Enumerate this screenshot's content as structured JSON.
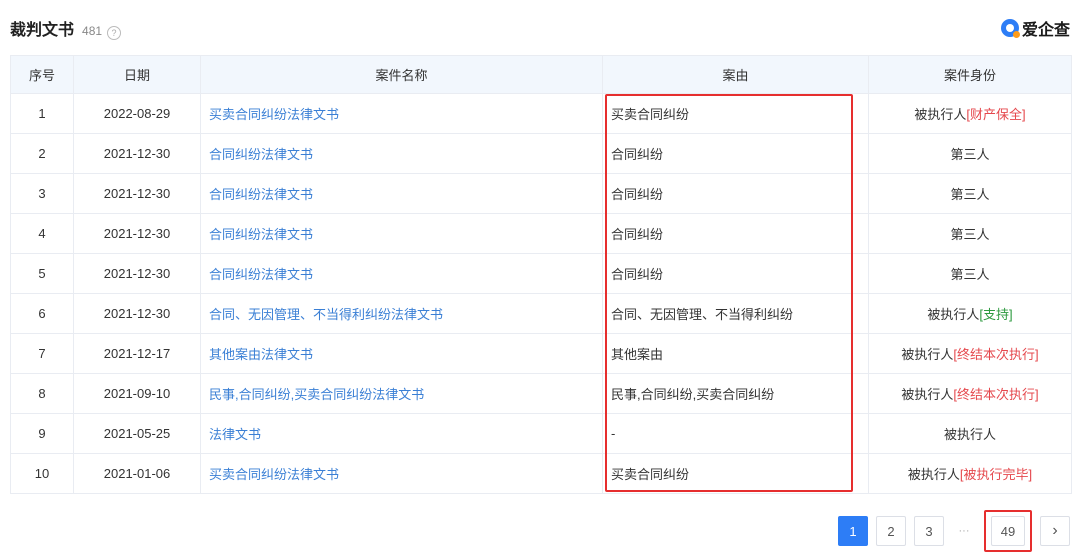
{
  "header": {
    "title": "裁判文书",
    "count": "481",
    "help_glyph": "?",
    "brand": "爱企查"
  },
  "table": {
    "columns": [
      "序号",
      "日期",
      "案件名称",
      "案由",
      "案件身份"
    ],
    "rows": [
      {
        "no": "1",
        "date": "2022-08-29",
        "name": "买卖合同纠纷法律文书",
        "cause": "买卖合同纠纷",
        "role": "被执行人",
        "role_suffix": "[财产保全]",
        "suffix_color": "red"
      },
      {
        "no": "2",
        "date": "2021-12-30",
        "name": "合同纠纷法律文书",
        "cause": "合同纠纷",
        "role": "第三人",
        "role_suffix": "",
        "suffix_color": ""
      },
      {
        "no": "3",
        "date": "2021-12-30",
        "name": "合同纠纷法律文书",
        "cause": "合同纠纷",
        "role": "第三人",
        "role_suffix": "",
        "suffix_color": ""
      },
      {
        "no": "4",
        "date": "2021-12-30",
        "name": "合同纠纷法律文书",
        "cause": "合同纠纷",
        "role": "第三人",
        "role_suffix": "",
        "suffix_color": ""
      },
      {
        "no": "5",
        "date": "2021-12-30",
        "name": "合同纠纷法律文书",
        "cause": "合同纠纷",
        "role": "第三人",
        "role_suffix": "",
        "suffix_color": ""
      },
      {
        "no": "6",
        "date": "2021-12-30",
        "name": "合同、无因管理、不当得利纠纷法律文书",
        "cause": "合同、无因管理、不当得利纠纷",
        "role": "被执行人",
        "role_suffix": "[支持]",
        "suffix_color": "green"
      },
      {
        "no": "7",
        "date": "2021-12-17",
        "name": "其他案由法律文书",
        "cause": "其他案由",
        "role": "被执行人",
        "role_suffix": "[终结本次执行]",
        "suffix_color": "red"
      },
      {
        "no": "8",
        "date": "2021-09-10",
        "name": "民事,合同纠纷,买卖合同纠纷法律文书",
        "cause": "民事,合同纠纷,买卖合同纠纷",
        "role": "被执行人",
        "role_suffix": "[终结本次执行]",
        "suffix_color": "red"
      },
      {
        "no": "9",
        "date": "2021-05-25",
        "name": "法律文书",
        "cause": "-",
        "role": "被执行人",
        "role_suffix": "",
        "suffix_color": ""
      },
      {
        "no": "10",
        "date": "2021-01-06",
        "name": "买卖合同纠纷法律文书",
        "cause": "买卖合同纠纷",
        "role": "被执行人",
        "role_suffix": "[被执行完毕]",
        "suffix_color": "red"
      }
    ]
  },
  "pagination": {
    "pages": [
      "1",
      "2",
      "3"
    ],
    "current": "1",
    "ellipsis": "···",
    "last": "49",
    "next_glyph": "›"
  },
  "colors": {
    "accent": "#2d7df6",
    "link": "#3a7fd5",
    "highlight": "#e62e2e",
    "status_red": "#e5484d",
    "status_green": "#2d9a3f"
  }
}
